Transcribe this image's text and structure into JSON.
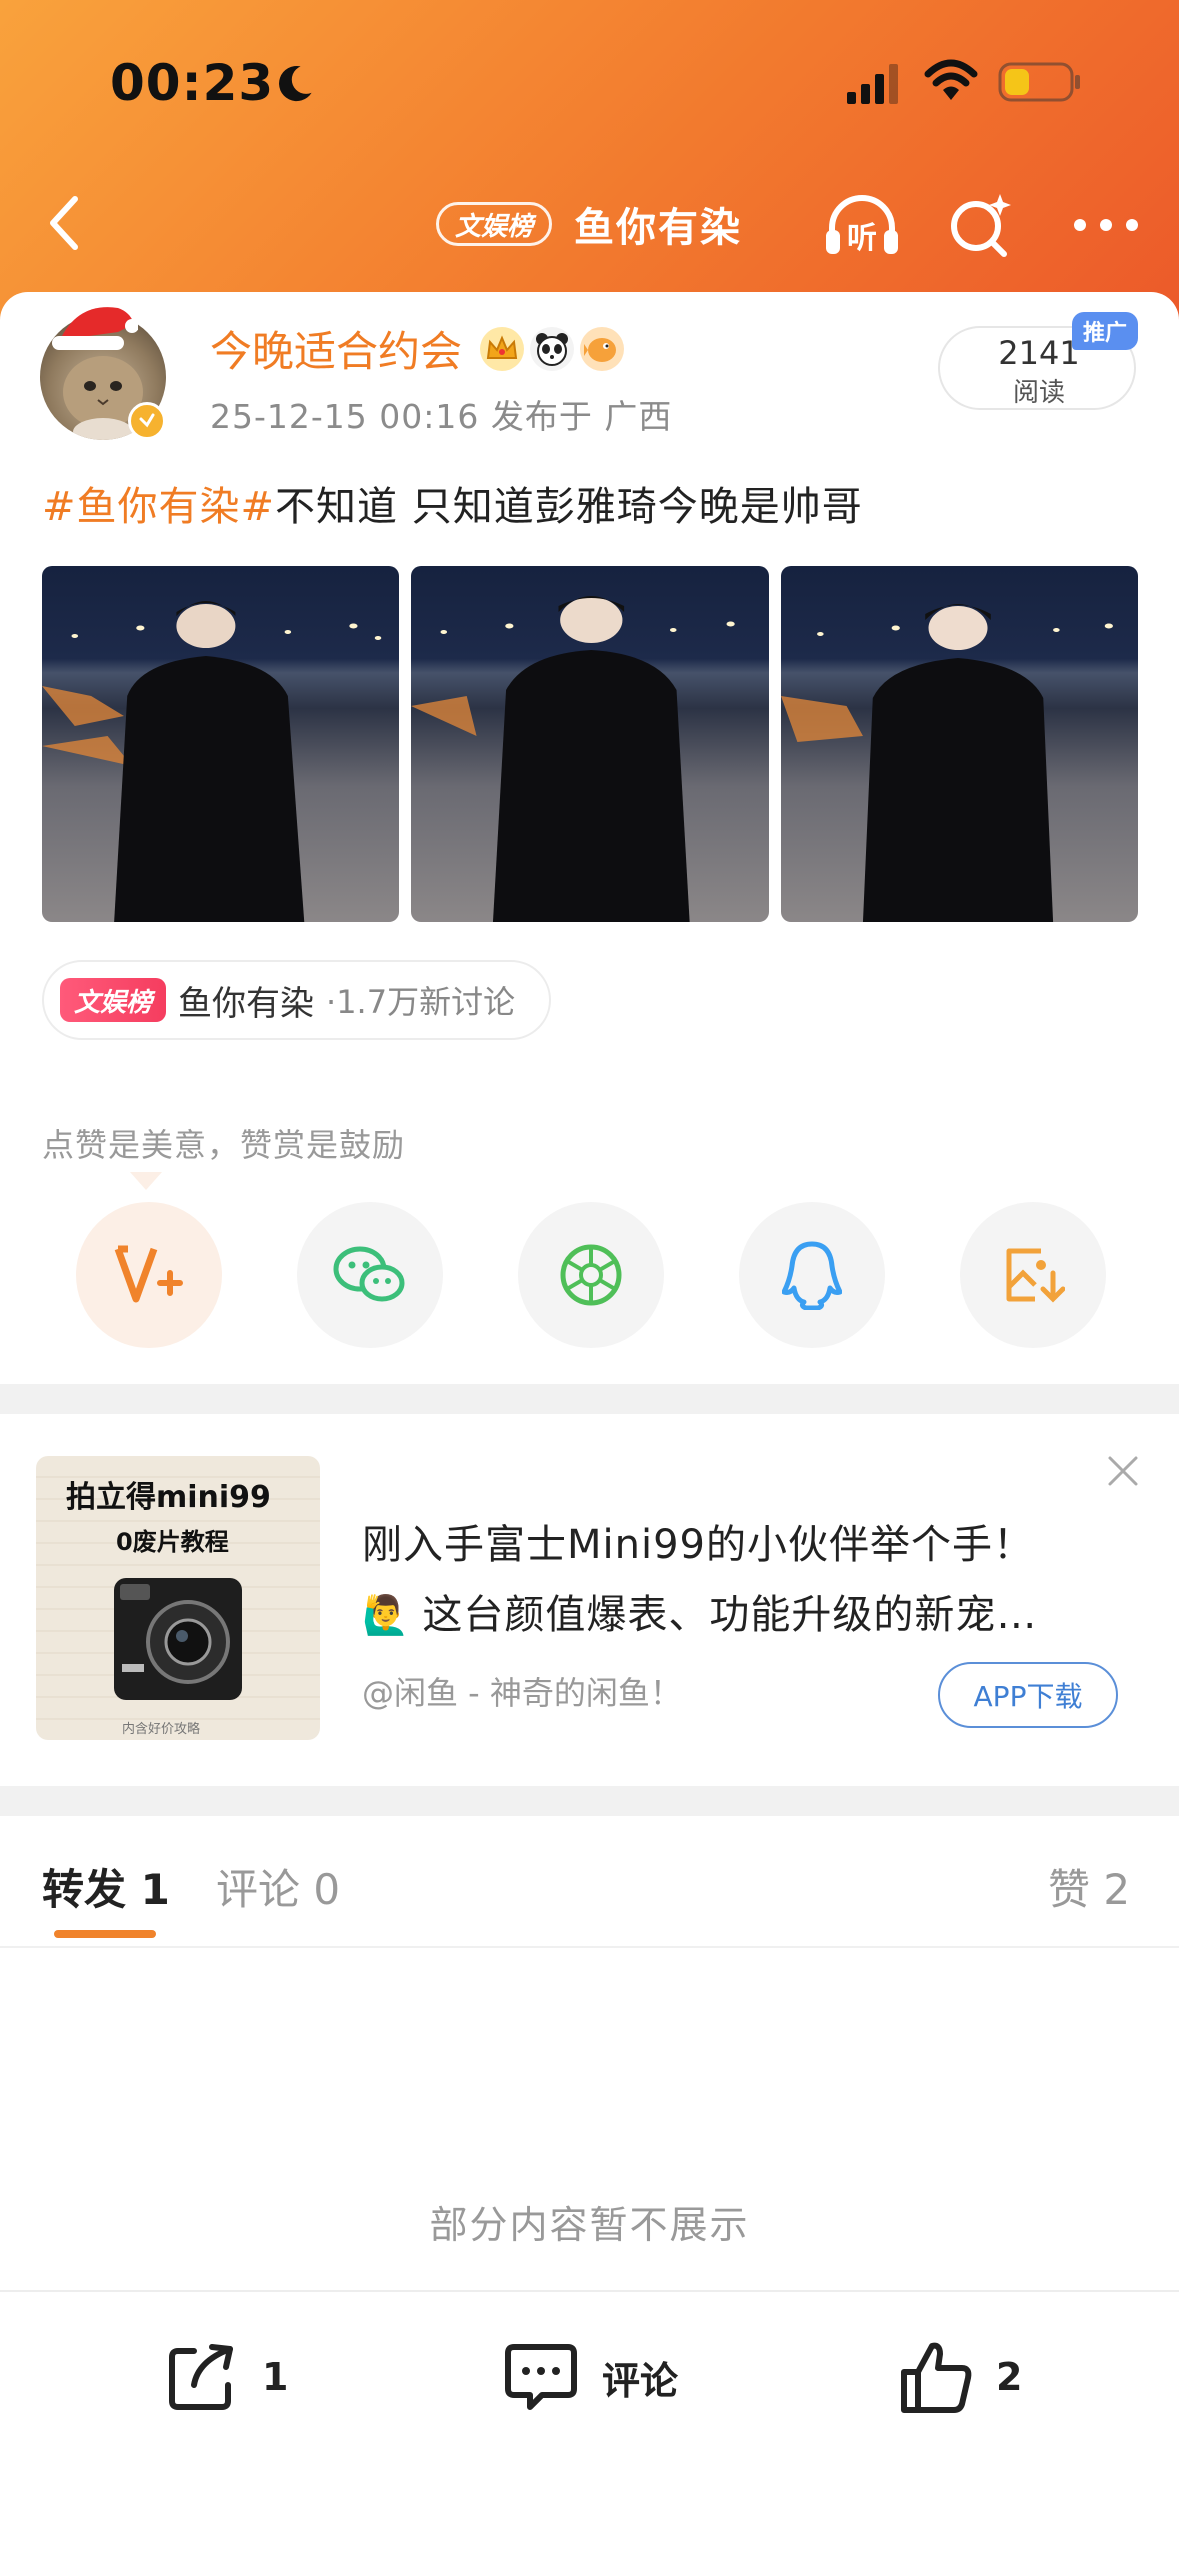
{
  "status_bar": {
    "time": "00:23",
    "focus_mode_icon": "moon-icon",
    "icons": [
      "signal-bars-icon",
      "wifi-icon",
      "battery-low-icon"
    ]
  },
  "nav": {
    "badge": "文娱榜",
    "title": "鱼你有染",
    "listen_label": "听",
    "icons": [
      "back-chevron-icon",
      "headphones-icon",
      "search-sparkle-icon",
      "more-dots-icon"
    ]
  },
  "post": {
    "username": "今晚适合约会",
    "user_badges": [
      "crown-icon",
      "panda-icon",
      "pufferfish-icon"
    ],
    "meta": "25-12-15 00:16  发布于 广西",
    "read_count": "2141",
    "read_label": "阅读",
    "promo_tag": "推广",
    "hashtag": "#鱼你有染#",
    "text": "不知道  只知道彭雅琦今晚是帅哥",
    "photo_count": 3
  },
  "topic": {
    "badge": "文娱榜",
    "name": "鱼你有染",
    "count": "·1.7万新讨论"
  },
  "reward": {
    "text": "点赞是美意，赞赏是鼓励",
    "share_buttons": [
      {
        "name": "reward-v-plus",
        "icon": "v-plus-icon"
      },
      {
        "name": "wechat",
        "icon": "wechat-icon"
      },
      {
        "name": "moments",
        "icon": "moments-aperture-icon"
      },
      {
        "name": "qq",
        "icon": "qq-penguin-icon"
      },
      {
        "name": "save-image",
        "icon": "save-image-icon"
      }
    ]
  },
  "ad": {
    "image_title": "拍立得mini99",
    "image_subtitle": "0废片教程",
    "image_footer": "内含好价攻略",
    "line1": "刚入手富士Mini99的小伙伴举个手！",
    "line2_emoji": "🙋‍♂️",
    "line2": "这台颜值爆表、功能升级的新宠…",
    "source": "@闲鱼 - 神奇的闲鱼！",
    "download_label": "APP下载"
  },
  "tabs": {
    "repost": "转发 1",
    "comment": "评论 0",
    "like": "赞 2"
  },
  "hidden_note": "部分内容暂不展示",
  "bottom_bar": {
    "repost_count": "1",
    "comment_label": "评论",
    "like_count": "2"
  },
  "colors": {
    "brand_orange": "#f07c24",
    "header_gradient_start": "#f9a23c",
    "header_gradient_end": "#ec5a2a",
    "link_blue": "#3f7fd4"
  }
}
